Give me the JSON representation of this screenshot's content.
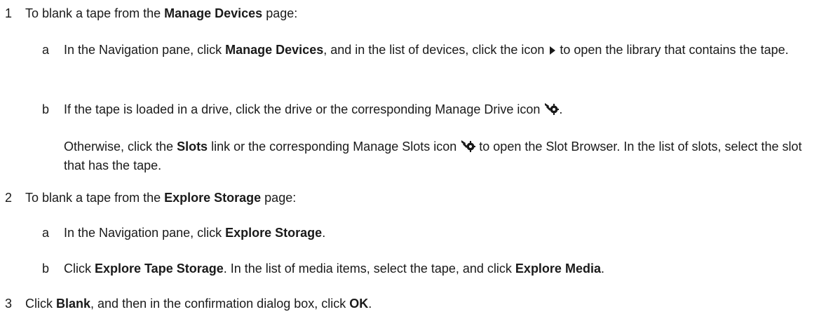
{
  "steps": [
    {
      "num": "1",
      "pre": "To blank a tape from the ",
      "bold": "Manage Devices",
      "post": " page:",
      "substeps": [
        {
          "letter": "a",
          "t1": "In the Navigation pane, click ",
          "b1": "Manage Devices",
          "t2": ", and in the list of devices, click the icon ",
          "t3": " to open the library that contains the tape.",
          "icon": "expand-arrow-icon"
        },
        {
          "letter": "b",
          "t1": "If the tape is loaded in a drive, click the drive or the corresponding Manage Drive icon ",
          "t2": ".",
          "icon": "manage-drive-icon",
          "para_t1": "Otherwise, click the ",
          "para_b1": "Slots",
          "para_t2": " link or the corresponding Manage Slots icon ",
          "para_t3": " to open the Slot Browser. In the list of slots, select the slot that has the tape.",
          "para_icon": "manage-slots-icon"
        }
      ]
    },
    {
      "num": "2",
      "pre": "To blank a tape from the ",
      "bold": "Explore Storage",
      "post": " page:",
      "substeps": [
        {
          "letter": "a",
          "t1": "In the Navigation pane, click ",
          "b1": "Explore Storage",
          "t2": "."
        },
        {
          "letter": "b",
          "t1": "Click ",
          "b1": "Explore Tape Storage",
          "t2": ". In the list of media items, select the tape, and click ",
          "b2": "Explore Media",
          "t3": "."
        }
      ]
    },
    {
      "num": "3",
      "t1": "Click ",
      "b1": "Blank",
      "t2": ", and then in the confirmation dialog box, click ",
      "b2": "OK",
      "t3": "."
    }
  ],
  "colors": {
    "text": "#1a1a1a",
    "icon": "#1a1a1a"
  }
}
